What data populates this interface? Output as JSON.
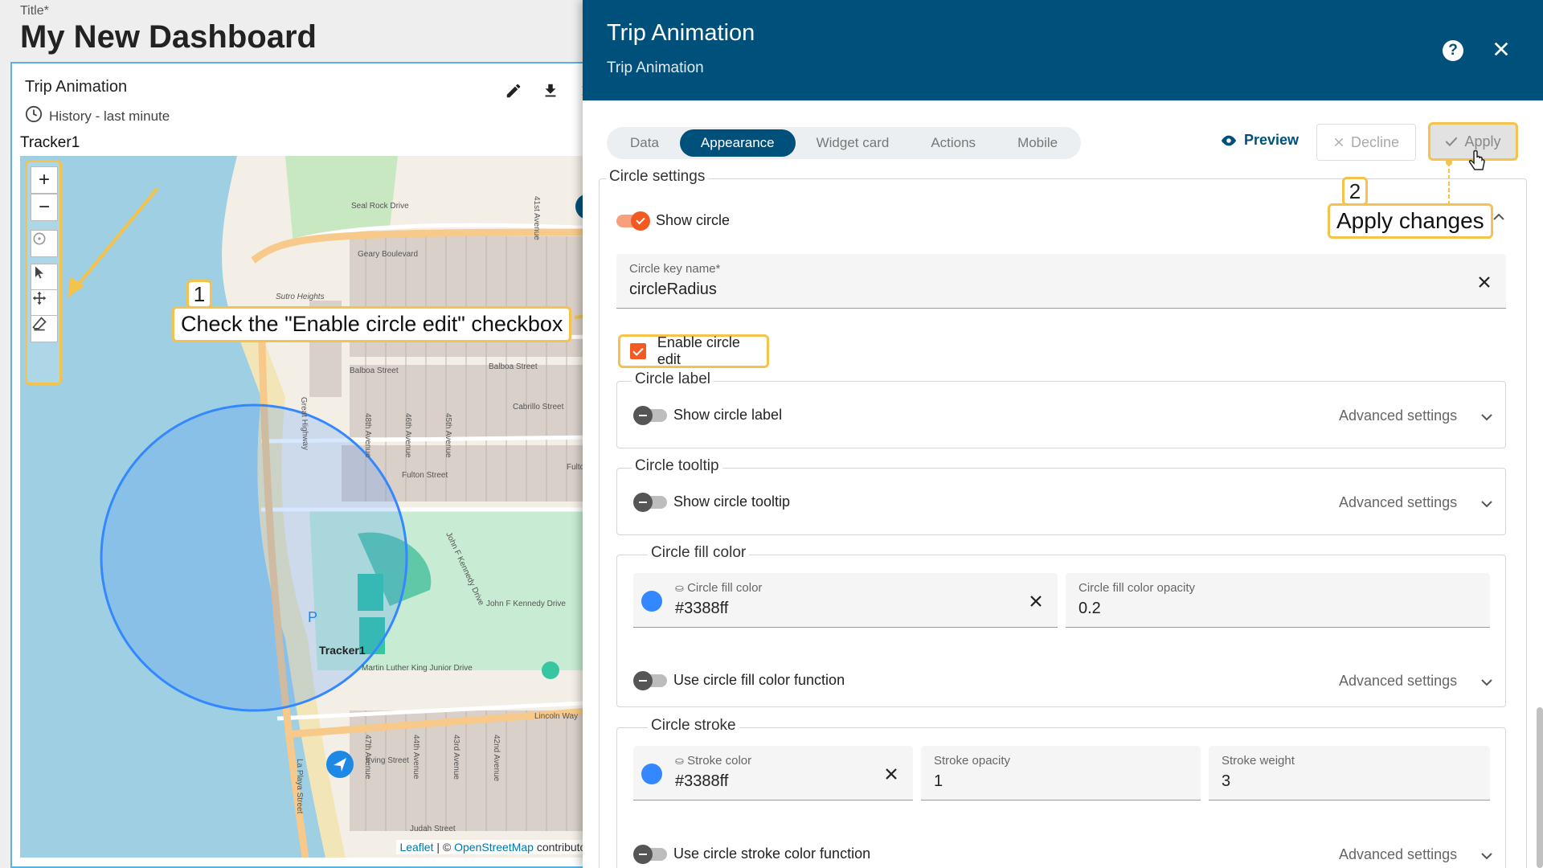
{
  "dashboard": {
    "title_label": "Title*",
    "title": "My New Dashboard",
    "widget": {
      "title": "Trip Animation",
      "subtitle": "History - last minute",
      "tracker_label": "Tracker1",
      "map": {
        "streets": [
          "Seal Rock Drive",
          "Geary Boulevard",
          "Sutro Heights",
          "Balboa Street",
          "Great Highway",
          "Fulton Street",
          "John F Kennedy Drive",
          "Martin Luther King Junior Drive",
          "Lincoln Way",
          "Irving Street",
          "Judah Street",
          "La Playa Street",
          "Cabrillo Street",
          "48th Avenue",
          "47th Avenue",
          "46th Avenue",
          "45th Avenue",
          "44th Avenue",
          "43rd Avenue",
          "42nd Avenue",
          "41st Avenue",
          "Fulton Str"
        ],
        "marker_label": "Tracker1",
        "attribution_leaflet": "Leaflet",
        "attribution_sep": " | © ",
        "attribution_osm": "OpenStreetMap",
        "attribution_rest": " contributors"
      },
      "tools": [
        "edit-icon",
        "download-icon",
        "close-icon"
      ]
    },
    "callout1": {
      "number": "1",
      "text": "Check the \"Enable circle edit\" checkbox"
    }
  },
  "panel": {
    "title": "Trip Animation",
    "subtitle": "Trip Animation",
    "tabs": [
      {
        "label": "Data"
      },
      {
        "label": "Appearance",
        "active": true
      },
      {
        "label": "Widget card"
      },
      {
        "label": "Actions"
      },
      {
        "label": "Mobile"
      }
    ],
    "preview_label": "Preview",
    "decline_label": "Decline",
    "apply_label": "Apply",
    "callout2": {
      "number": "2",
      "text": "Apply changes"
    },
    "circle_settings": {
      "legend": "Circle settings",
      "show_circle": "Show circle",
      "key_name": {
        "label": "Circle key name*",
        "value": "circleRadius"
      },
      "enable_edit": "Enable circle edit"
    },
    "circle_label": {
      "legend": "Circle label",
      "toggle": "Show circle label",
      "advanced": "Advanced settings"
    },
    "circle_tooltip": {
      "legend": "Circle tooltip",
      "toggle": "Show circle tooltip",
      "advanced": "Advanced settings"
    },
    "circle_fill": {
      "legend": "Circle fill color",
      "color_label": "Circle fill color",
      "color_value": "#3388ff",
      "opacity_label": "Circle fill color opacity",
      "opacity_value": "0.2",
      "function_toggle": "Use circle fill color function",
      "advanced": "Advanced settings"
    },
    "circle_stroke": {
      "legend": "Circle stroke",
      "color_label": "Stroke color",
      "color_value": "#3388ff",
      "opacity_label": "Stroke opacity",
      "opacity_value": "1",
      "weight_label": "Stroke weight",
      "weight_value": "3",
      "function_toggle": "Use circle stroke color function",
      "advanced": "Advanced settings"
    }
  },
  "colors": {
    "header": "#00507c",
    "accent": "#f35a22",
    "highlight": "#f5c24c",
    "circle": "#3388ff"
  }
}
